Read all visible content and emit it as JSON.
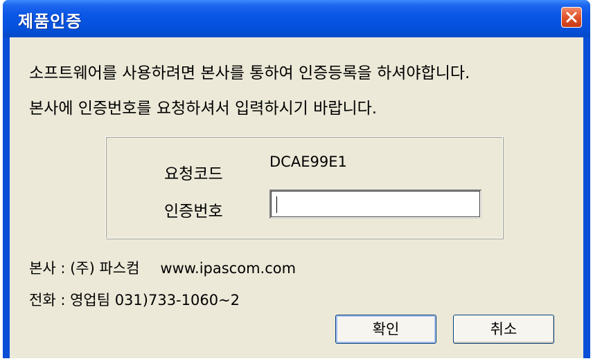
{
  "window": {
    "title": "제품인증"
  },
  "message": {
    "line1": "소프트웨어를 사용하려면 본사를 통하여 인증등록을 하셔야합니다.",
    "line2": "본사에 인증번호를 요청하셔서 입력하시기 바랍니다."
  },
  "request": {
    "label": "요청코드",
    "code": "DCAE99E1"
  },
  "auth": {
    "label": "인증번호",
    "value": ""
  },
  "company": {
    "text": "본사 : (주) 파스컴",
    "website": "www.ipascom.com"
  },
  "phone": {
    "text": "전화 : 영업팀 031)733-1060~2"
  },
  "buttons": {
    "ok": "확인",
    "cancel": "취소"
  },
  "icons": {
    "close": "close-icon"
  },
  "colors": {
    "titlebar": "#0a56e6",
    "close_button": "#e0532a",
    "client_bg": "#ece9d8"
  }
}
